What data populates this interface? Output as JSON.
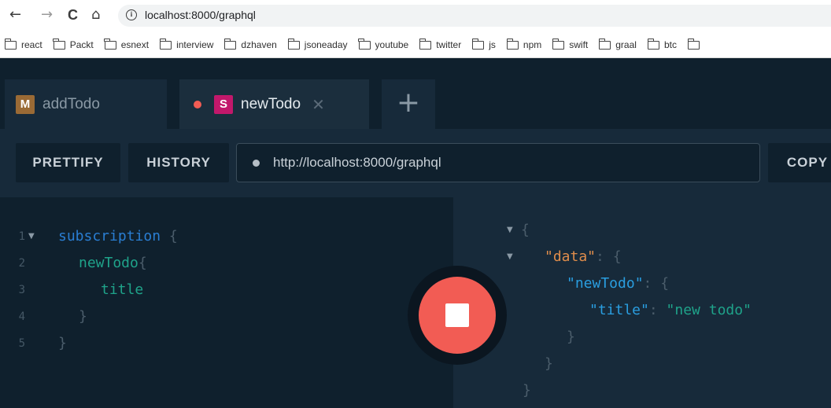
{
  "browser": {
    "back_icon": "←",
    "forward_icon": "→",
    "reload_icon": "C",
    "home_icon": "⌂",
    "info_icon": "i",
    "url": "localhost:8000/graphql"
  },
  "bookmarks": [
    "react",
    "Packt",
    "esnext",
    "interview",
    "dzhaven",
    "jsoneaday",
    "youtube",
    "twitter",
    "js",
    "npm",
    "swift",
    "graal",
    "btc",
    ""
  ],
  "tabs": [
    {
      "badge": "M",
      "badge_color": "#9a6a35",
      "label": "addTodo"
    },
    {
      "badge": "S",
      "badge_color": "#c2186b",
      "label": "newTodo",
      "close": "✕"
    }
  ],
  "add_tab": "+",
  "controls": {
    "prettify": "PRETTIFY",
    "history": "HISTORY",
    "endpoint": "http://localhost:8000/graphql",
    "copy": "COPY"
  },
  "editor": {
    "lines": [
      "1",
      "2",
      "3",
      "4",
      "5"
    ],
    "keyword": "subscription",
    "open_brace": "{",
    "field": "newTodo",
    "sub_field": "title",
    "close_inner": "}",
    "close_outer": "}"
  },
  "result": {
    "open": "{",
    "data_key": "\"data\"",
    "newtodo_key": "\"newTodo\"",
    "title_key": "\"title\"",
    "title_value": "\"new todo\"",
    "colon": ":",
    "brace_open": "{",
    "brace_close": "}"
  },
  "colors": {
    "accent_stop": "#f25c54",
    "background": "#0f202d",
    "panel": "#172a3a"
  }
}
